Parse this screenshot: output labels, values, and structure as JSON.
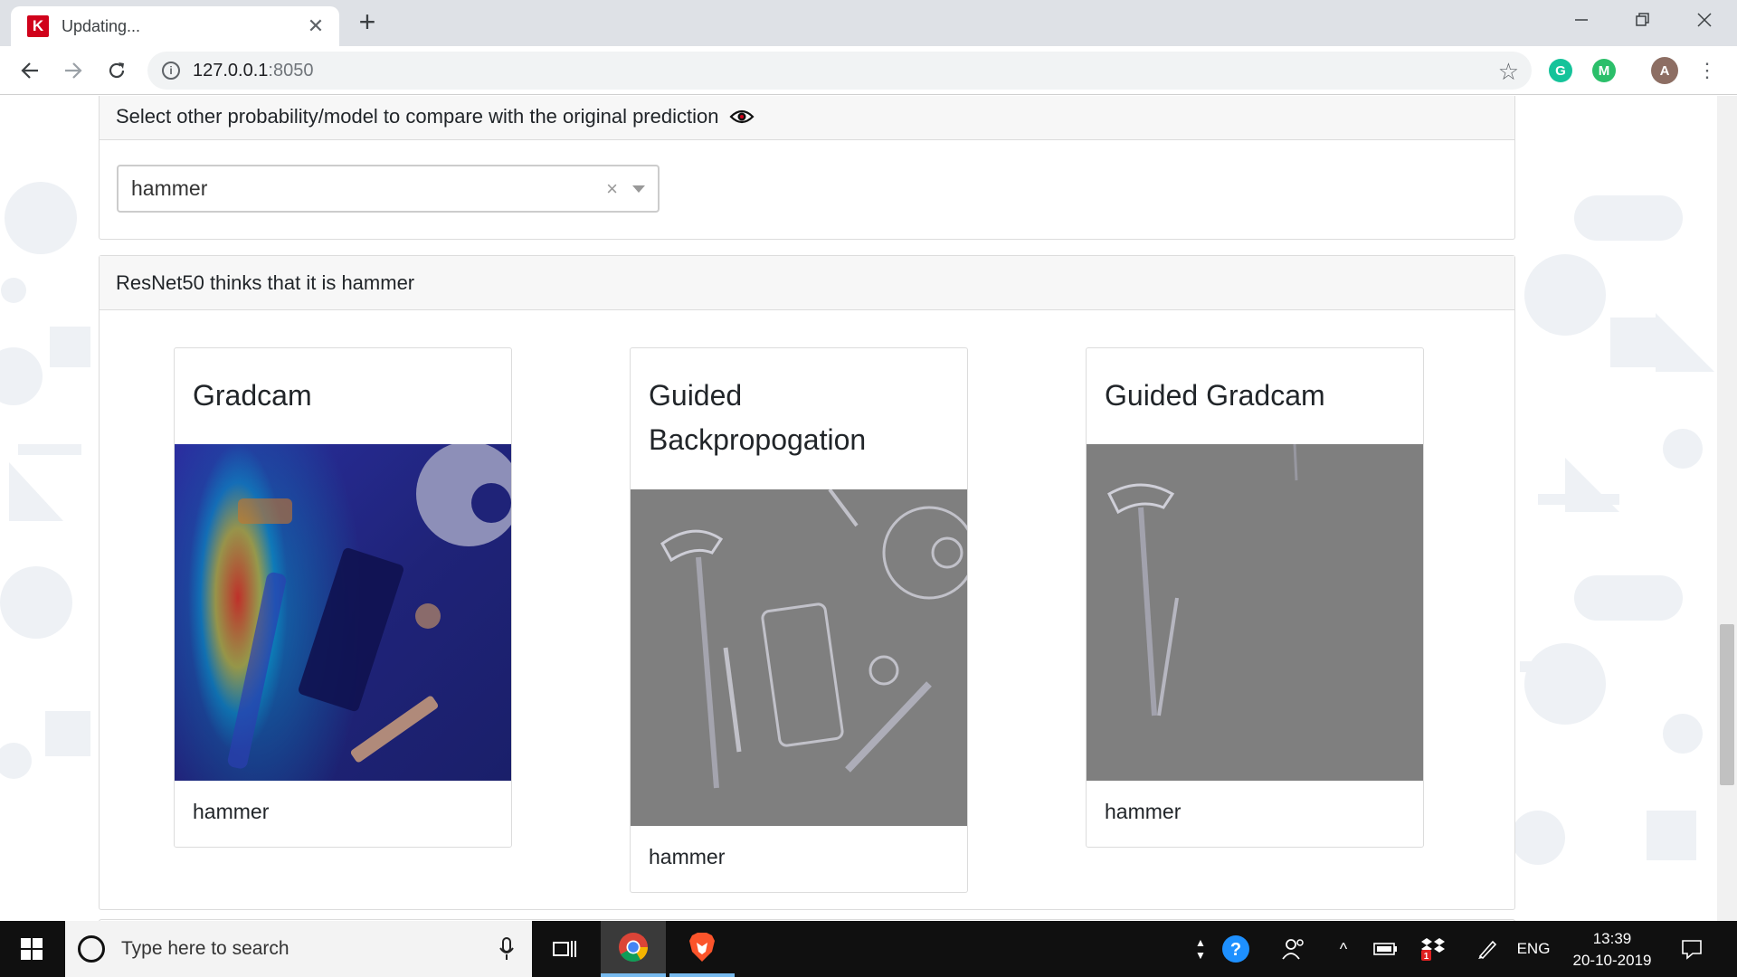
{
  "browser": {
    "tab_title": "Updating...",
    "tab_favicon_letter": "K",
    "url_host": "127.0.0.1",
    "url_port": ":8050",
    "profile_initial": "A",
    "ext_grammarly": "G",
    "ext_m": "M"
  },
  "compare_panel": {
    "header": "Select other probability/model to compare with the original prediction",
    "dropdown": {
      "selected": "hammer",
      "clear_glyph": "×"
    }
  },
  "results_panel": {
    "header": "ResNet50 thinks that it is hammer",
    "cards": [
      {
        "title": "Gradcam",
        "caption": "hammer"
      },
      {
        "title": "Guided Backpropogation",
        "caption": "hammer"
      },
      {
        "title": "Guided Gradcam",
        "caption": "hammer"
      }
    ]
  },
  "taskbar": {
    "search_placeholder": "Type here to search",
    "language": "ENG",
    "time": "13:39",
    "date": "20-10-2019",
    "dropbox_badge": "1"
  },
  "colors": {
    "accent": "#76b9ed",
    "favicon": "#d0021b",
    "grammarly": "#15c39a",
    "header_bg": "#f7f7f7"
  }
}
